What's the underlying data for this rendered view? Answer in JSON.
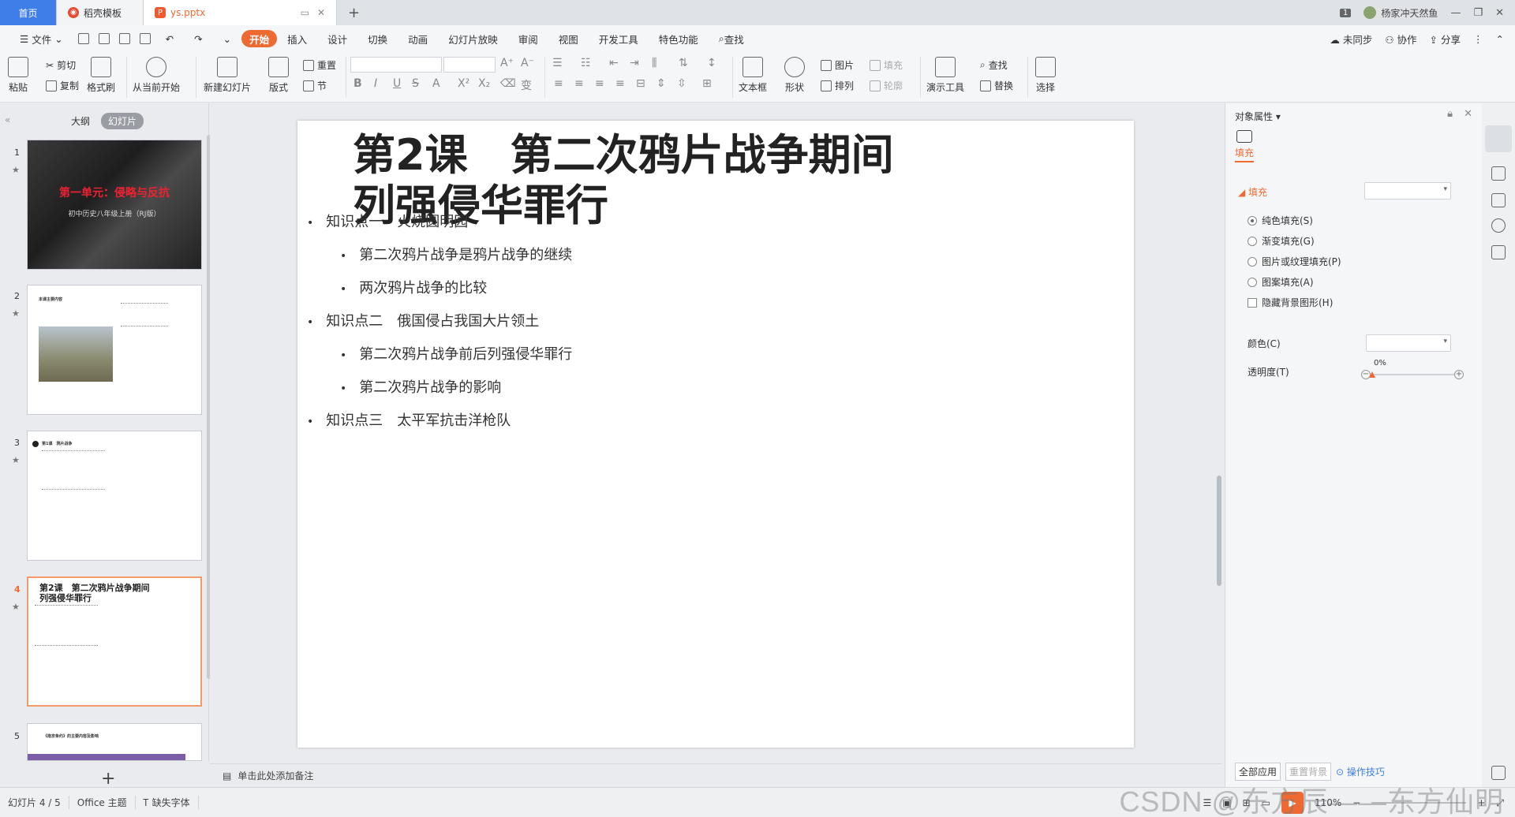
{
  "tabs": {
    "home": "首页",
    "template": "稻壳模板",
    "file": "ys.pptx"
  },
  "titlebar": {
    "badge": "1",
    "user": "杨家冲天然鱼"
  },
  "menu": {
    "file": "文件",
    "items": [
      "开始",
      "插入",
      "设计",
      "切换",
      "动画",
      "幻灯片放映",
      "审阅",
      "视图",
      "开发工具",
      "特色功能"
    ],
    "search": "查找",
    "sync": "未同步",
    "collab": "协作",
    "share": "分享"
  },
  "ribbon": {
    "paste": "粘贴",
    "cut": "剪切",
    "copy": "复制",
    "format_painter": "格式刷",
    "from_current": "从当前开始",
    "new_slide": "新建幻灯片",
    "layout": "版式",
    "reset": "重置",
    "section": "节",
    "textbox": "文本框",
    "shape": "形状",
    "picture": "图片",
    "fill": "填充",
    "arrange": "排列",
    "outline": "轮廓",
    "present_tools": "演示工具",
    "find": "查找",
    "replace": "替换",
    "select": "选择"
  },
  "left_panel": {
    "outline_tab": "大纲",
    "slides_tab": "幻灯片",
    "slides": [
      {
        "num": "1",
        "title": "第一单元：侵略与反抗",
        "subtitle": "初中历史八年级上册（RJ版）"
      },
      {
        "num": "2",
        "title": "本课主要内容"
      },
      {
        "num": "3",
        "title": "第1课　鸦片战争"
      },
      {
        "num": "4",
        "title": "第2课　第二次鸦片战争期间 列强侵华罪行"
      },
      {
        "num": "5",
        "title": "《南京条约》的主要内容及影响"
      }
    ]
  },
  "slide": {
    "title_line1": "第2课　第二次鸦片战争期间",
    "title_line2": "列强侵华罪行",
    "bullets": [
      {
        "level": 1,
        "text": "知识点一　火烧圆明园"
      },
      {
        "level": 2,
        "text": "第二次鸦片战争是鸦片战争的继续"
      },
      {
        "level": 2,
        "text": "两次鸦片战争的比较"
      },
      {
        "level": 1,
        "text": "知识点二　俄国侵占我国大片领土"
      },
      {
        "level": 2,
        "text": "第二次鸦片战争前后列强侵华罪行"
      },
      {
        "level": 2,
        "text": "第二次鸦片战争的影响"
      },
      {
        "level": 1,
        "text": "知识点三　太平军抗击洋枪队"
      }
    ]
  },
  "notes": {
    "placeholder": "单击此处添加备注"
  },
  "right_panel": {
    "title": "对象属性",
    "tab": "填充",
    "section": "填充",
    "options": [
      "纯色填充(S)",
      "渐变填充(G)",
      "图片或纹理填充(P)",
      "图案填充(A)"
    ],
    "hide_bg": "隐藏背景图形(H)",
    "color_label": "颜色(C)",
    "transparency_label": "透明度(T)",
    "transparency_value": "0%",
    "apply_all": "全部应用",
    "reset_bg": "重置背景",
    "tips": "操作技巧"
  },
  "status": {
    "slide_info": "幻灯片 4 / 5",
    "theme": "Office 主题",
    "missing_font": "缺失字体",
    "zoom": "110%"
  },
  "watermark": "CSDN @东方辰——东方仙明"
}
